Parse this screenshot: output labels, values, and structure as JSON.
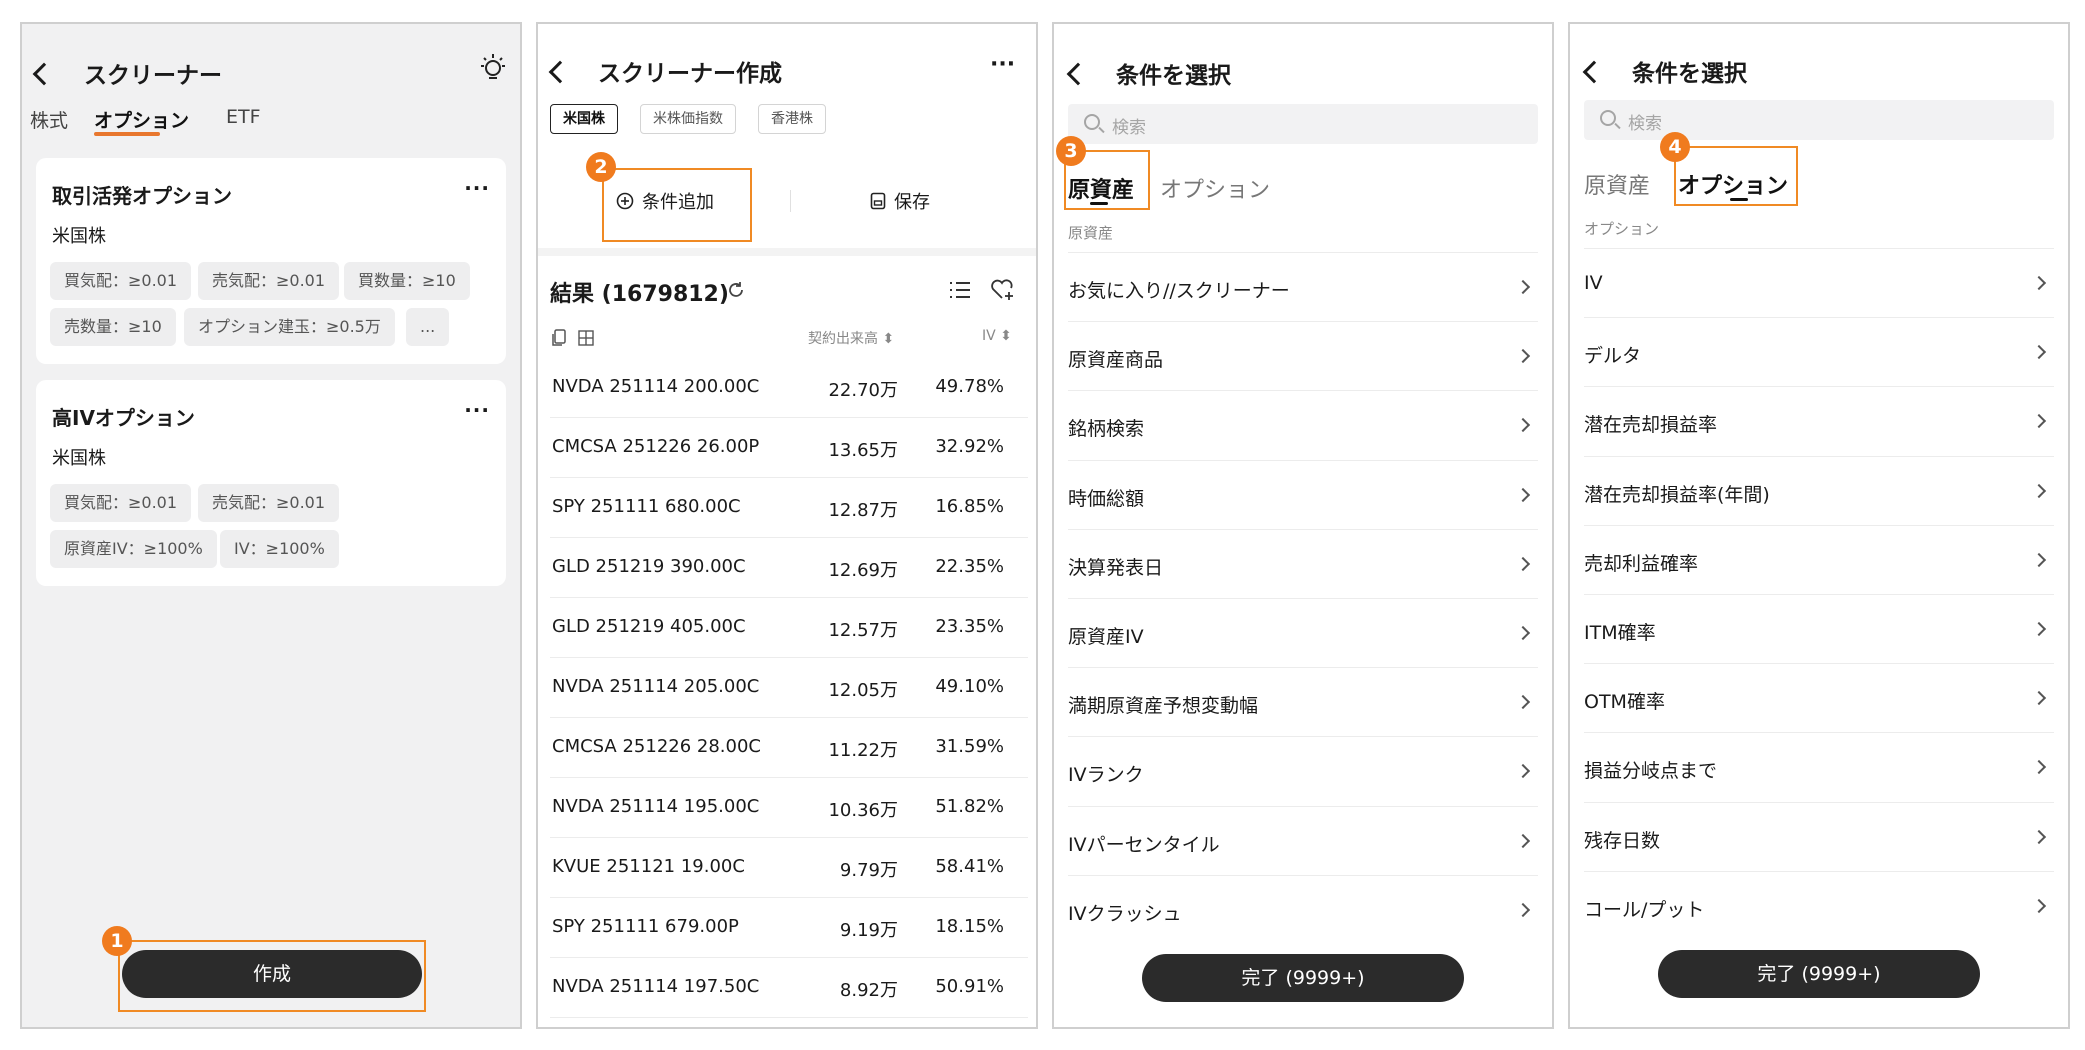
{
  "panel1": {
    "title": "スクリーナー",
    "tabs": [
      "株式",
      "オプション",
      "ETF"
    ],
    "cards": [
      {
        "title": "取引活発オプション",
        "market": "米国株",
        "chips": [
          "買気配：≥0.01",
          "売気配：≥0.01",
          "買数量：≥10",
          "売数量：≥10",
          "オプション建玉：≥0.5万",
          "..."
        ]
      },
      {
        "title": "高IVオプション",
        "market": "米国株",
        "chips": [
          "買気配：≥0.01",
          "売気配：≥0.01",
          "原資産IV：≥100%",
          "IV：≥100%"
        ]
      }
    ],
    "more": "···",
    "create_button": "作成",
    "badge": "1"
  },
  "panel2": {
    "title": "スクリーナー作成",
    "more": "···",
    "segments": [
      "米国株",
      "米株価指数",
      "香港株"
    ],
    "add_condition": "条件追加",
    "save": "保存",
    "results_label": "結果 (1679812)",
    "col_volume": "契約出来高 ⬍",
    "col_iv": "IV ⬍",
    "badge": "2",
    "rows": [
      {
        "name": "NVDA 251114 200.00C",
        "volume": "22.70万",
        "iv": "49.78%"
      },
      {
        "name": "CMCSA 251226 26.00P",
        "volume": "13.65万",
        "iv": "32.92%"
      },
      {
        "name": "SPY 251111 680.00C",
        "volume": "12.87万",
        "iv": "16.85%"
      },
      {
        "name": "GLD 251219 390.00C",
        "volume": "12.69万",
        "iv": "22.35%"
      },
      {
        "name": "GLD 251219 405.00C",
        "volume": "12.57万",
        "iv": "23.35%"
      },
      {
        "name": "NVDA 251114 205.00C",
        "volume": "12.05万",
        "iv": "49.10%"
      },
      {
        "name": "CMCSA 251226 28.00C",
        "volume": "11.22万",
        "iv": "31.59%"
      },
      {
        "name": "NVDA 251114 195.00C",
        "volume": "10.36万",
        "iv": "51.82%"
      },
      {
        "name": "KVUE 251121 19.00C",
        "volume": "9.79万",
        "iv": "58.41%"
      },
      {
        "name": "SPY 251111 679.00P",
        "volume": "9.19万",
        "iv": "18.15%"
      },
      {
        "name": "NVDA 251114 197.50C",
        "volume": "8.92万",
        "iv": "50.91%"
      }
    ]
  },
  "panel3": {
    "title": "条件を選択",
    "search_placeholder": "検索",
    "tabs": [
      "原資産",
      "オプション"
    ],
    "section": "原資産",
    "badge": "3",
    "items": [
      "お気に入り//スクリーナー",
      "原資産商品",
      "銘柄検索",
      "時価総額",
      "決算発表日",
      "原資産IV",
      "満期原資産予想変動幅",
      "IVランク",
      "IVパーセンタイル",
      "IVクラッシュ"
    ],
    "done_button": "完了 (9999+)"
  },
  "panel4": {
    "title": "条件を選択",
    "search_placeholder": "検索",
    "tabs": [
      "原資産",
      "オプション"
    ],
    "section": "オプション",
    "badge": "4",
    "items": [
      "IV",
      "デルタ",
      "潜在売却損益率",
      "潜在売却損益率(年間)",
      "売却利益確率",
      "ITM確率",
      "OTM確率",
      "損益分岐点まで",
      "残存日数",
      "コール/プット"
    ],
    "done_button": "完了 (9999+)"
  },
  "colors": {
    "accent": "#f08a24",
    "badge": "#f07b1e",
    "button": "#2b2b2b"
  },
  "icons": [
    "back-icon",
    "lightbulb-icon",
    "more-icon",
    "plus-circle-icon",
    "save-icon",
    "refresh-icon",
    "list-icon",
    "heart-add-icon",
    "copy-icon",
    "grid-icon",
    "search-icon",
    "chevron-right-icon"
  ]
}
